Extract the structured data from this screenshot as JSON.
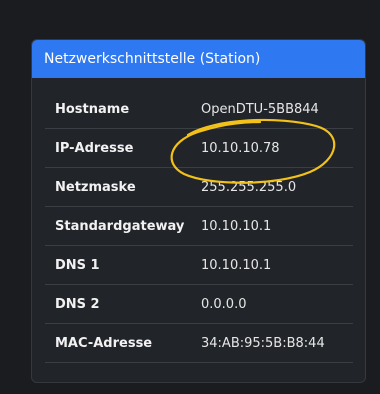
{
  "card": {
    "title": "Netzwerkschnittstelle (Station)",
    "rows": [
      {
        "label": "Hostname",
        "value": "OpenDTU-5BB844"
      },
      {
        "label": "IP-Adresse",
        "value": "10.10.10.78"
      },
      {
        "label": "Netzmaske",
        "value": "255.255.255.0"
      },
      {
        "label": "Standardgateway",
        "value": "10.10.10.1"
      },
      {
        "label": "DNS 1",
        "value": "10.10.10.1"
      },
      {
        "label": "DNS 2",
        "value": "0.0.0.0"
      },
      {
        "label": "MAC-Adresse",
        "value": "34:AB:95:5B:B8:44"
      }
    ]
  },
  "colors": {
    "background": "#1b1c20",
    "card_background": "#212429",
    "header_accent": "#2e78f2",
    "annotation_ring": "#f2c21b"
  }
}
